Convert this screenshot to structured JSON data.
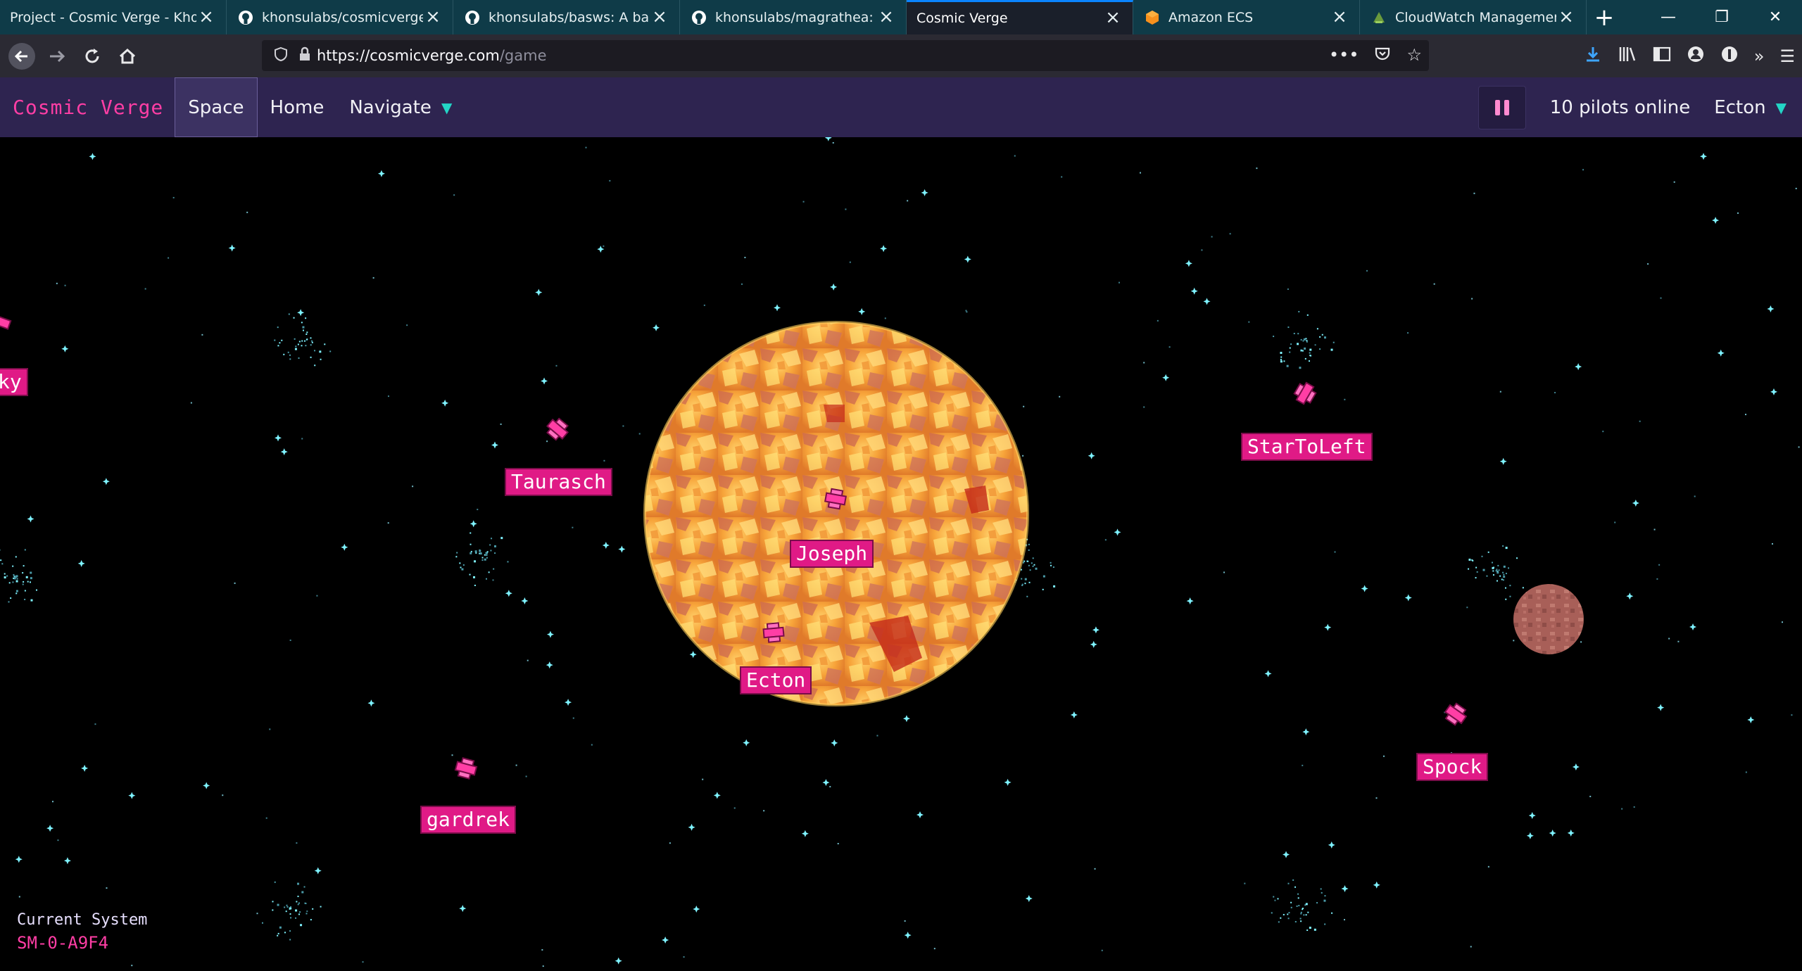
{
  "browser": {
    "tabs": [
      {
        "title": "Project - Cosmic Verge - Khonsul",
        "icon": "project-icon",
        "active": false
      },
      {
        "title": "khonsulabs/cosmicverge",
        "icon": "github-icon",
        "active": false
      },
      {
        "title": "khonsulabs/basws: A basis fo",
        "icon": "github-icon",
        "active": false
      },
      {
        "title": "khonsulabs/magrathea: A pi",
        "icon": "github-icon",
        "active": false
      },
      {
        "title": "Cosmic Verge",
        "icon": "",
        "active": true
      },
      {
        "title": "Amazon ECS",
        "icon": "aws-icon",
        "active": false
      },
      {
        "title": "CloudWatch Management C",
        "icon": "cloudwatch-icon",
        "active": false
      }
    ],
    "url_host": "https://cosmicverge.com",
    "url_path": "/game"
  },
  "app": {
    "logo": "Cosmic Verge",
    "nav": {
      "space": "Space",
      "home": "Home",
      "navigate": "Navigate"
    },
    "pilots_online": "10 pilots online",
    "user": "Ecton"
  },
  "game": {
    "pilots": [
      {
        "name": "Taurasch"
      },
      {
        "name": "Joseph"
      },
      {
        "name": "Ecton"
      },
      {
        "name": "StarToLeft"
      },
      {
        "name": "Spock"
      },
      {
        "name": "gardrek"
      },
      {
        "name": "ky"
      }
    ],
    "current_system_label": "Current System",
    "current_system": "SM-0-A9F4"
  },
  "colors": {
    "accent": "#ff3ea5",
    "header": "#2e2450",
    "star": "#7ff3ff",
    "label_bg": "#e01a86"
  }
}
